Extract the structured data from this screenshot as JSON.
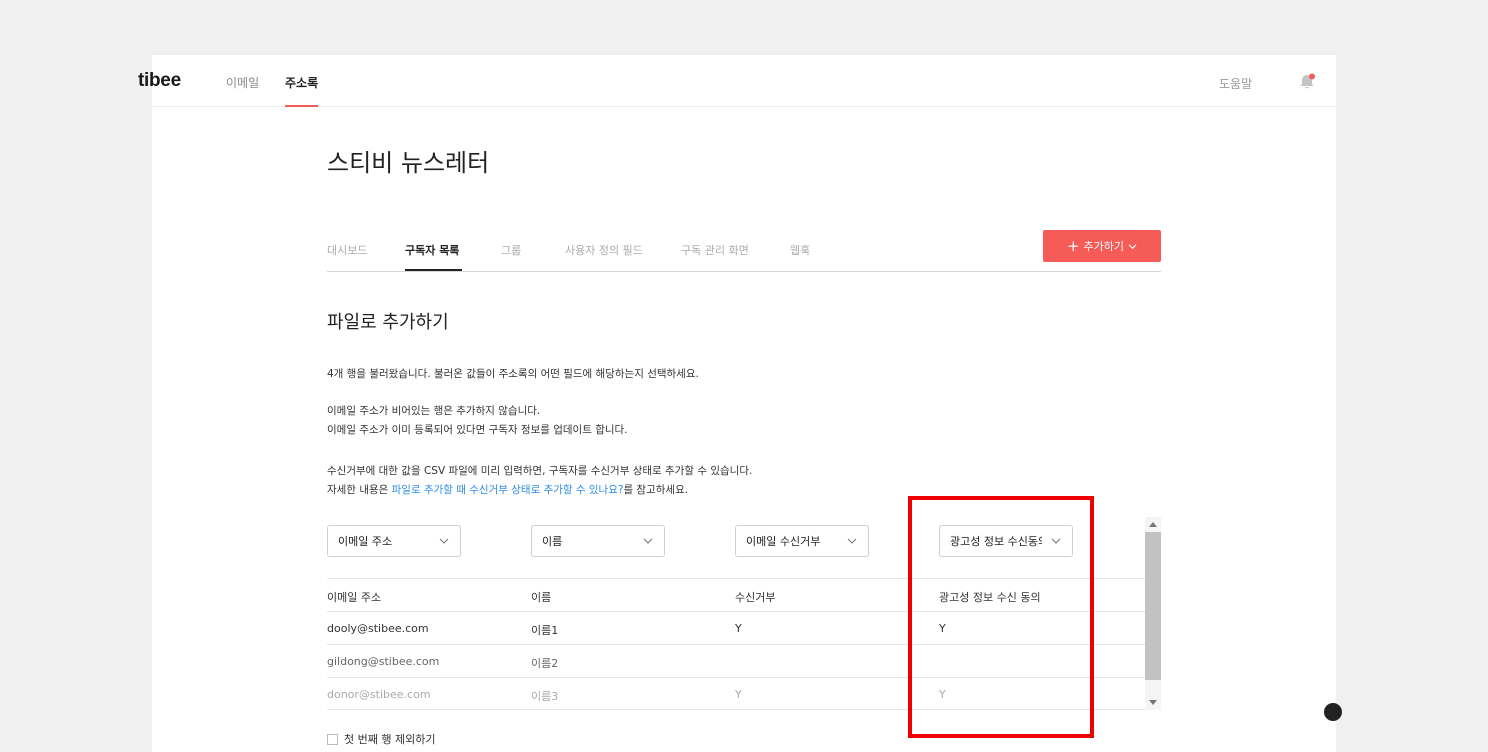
{
  "topnav": {
    "logo": "tibee",
    "items": [
      {
        "label": "이메일"
      },
      {
        "label": "주소록"
      }
    ],
    "help": "도움말"
  },
  "page": {
    "title": "스티비 뉴스레터",
    "tabs": [
      {
        "label": "대시보드"
      },
      {
        "label": "구독자 목록"
      },
      {
        "label": "그룹"
      },
      {
        "label": "사용자 정의 필드"
      },
      {
        "label": "구독 관리 화면"
      },
      {
        "label": "웹훅"
      }
    ],
    "add_button": "추가하기"
  },
  "section": {
    "title": "파일로 추가하기",
    "p1": "4개 행을 불러왔습니다. 불러온 값들이 주소록의 어떤 필드에 해당하는지 선택하세요.",
    "p2a": "이메일 주소가 비어있는 행은 추가하지 않습니다.",
    "p2b": "이메일 주소가 이미 등록되어 있다면 구독자 정보를 업데이트 합니다.",
    "p3a": "수신거부에 대한 값을 CSV 파일에 미리 입력하면, 구독자를 수신거부 상태로 추가할 수 있습니다.",
    "p3b_pre": "자세한 내용은 ",
    "p3b_link": "파일로 추가할 때 수신거부 상태로 추가할 수 있나요?",
    "p3b_post": "를 참고하세요."
  },
  "selects": [
    "이메일 주소",
    "이름",
    "이메일 수신거부",
    "광고성 정보 수신동의"
  ],
  "table": {
    "header": [
      "이메일 주소",
      "이름",
      "수신거부",
      "광고성 정보 수신 동의"
    ],
    "rows": [
      [
        "dooly@stibee.com",
        "이름1",
        "Y",
        "Y"
      ],
      [
        "gildong@stibee.com",
        "이름2",
        "",
        ""
      ],
      [
        "donor@stibee.com",
        "이름3",
        "Y",
        "Y"
      ]
    ]
  },
  "exclude_first_row": "첫 번째 행 제외하기",
  "colors": {
    "accent": "#f55b57",
    "link": "#2e8de6",
    "highlight": "#ee0000"
  },
  "icons": [
    "bell-icon",
    "chevron-down-icon",
    "plus-icon"
  ]
}
